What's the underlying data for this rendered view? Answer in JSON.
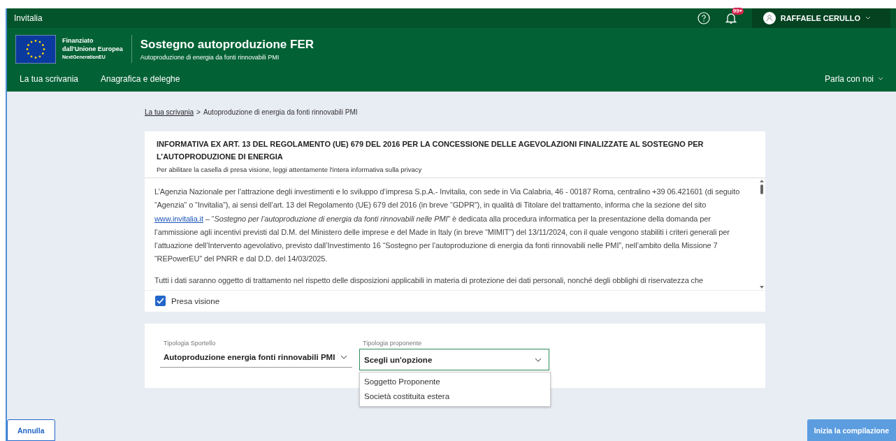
{
  "topbar": {
    "brand": "Invitalia",
    "notifications_badge": "99+",
    "user_name": "RAFFAELE CERULLO"
  },
  "header": {
    "eu_lines": [
      "Finanziato",
      "dall'Unione Europea",
      "NextGenerationEU"
    ],
    "title": "Sostegno autoproduzione FER",
    "subtitle": "Autoproduzione di energia da fonti rinnovabili PMI"
  },
  "nav": {
    "items": [
      {
        "label": "La tua scrivania"
      },
      {
        "label": "Anagrafica e deleghe"
      }
    ],
    "contact": "Parla con noi"
  },
  "breadcrumb": {
    "link": "La tua scrivania",
    "separator": ">",
    "current": "Autoproduzione di energia da fonti rinnovabili PMI"
  },
  "informativa": {
    "title": "INFORMATIVA EX ART. 13 DEL REGOLAMENTO (UE) 679 DEL 2016 PER LA CONCESSIONE DELLE AGEVOLAZIONI FINALIZZATE AL SOSTEGNO PER L’AUTOPRODUZIONE DI ENERGIA",
    "hint": "Per abilitare la casella di presa visione, leggi attentamente l'intera informativa sulla privacy",
    "paragraphs": [
      {
        "before": "L’Agenzia Nazionale per l’attrazione degli investimenti e lo sviluppo d’impresa S.p.A.- Invitalia, con sede in Via Calabria, 46 - 00187 Roma, centralino +39 06.421601 (di seguito “Agenzia” o “Invitalia”), ai sensi dell’art. 13 del Regolamento (UE) 679 del 2016 (in breve  “GDPR”), in qualità di Titolare del trattamento, informa che la sezione del sito ",
        "link": "www.invitalia.it",
        "after": " – “*Sostegno per l’autoproduzione di energia da fonti rinnovabili nelle PMI*” è dedicata alla procedura informatica per la presentazione della domanda per l’ammissione agli incentivi previsti dal D.M. del Ministero delle imprese e del Made in Italy (in breve “MIMIT”) del 13/11/2024, con il quale vengono stabiliti i criteri generali per l’attuazione dell’Intervento agevolativo, previsto dall’Investimento 16 “Sostegno per l’autoproduzione di energia da fonti rinnovabili nelle PMI”, nell’ambito della Missione 7 “REPowerEU” del PNRR e dal D.D. del 14/03/2025."
      },
      {
        "before": "Tutti i dati saranno oggetto di trattamento nel rispetto delle disposizioni applicabili in materia di protezione dei dati personali, nonché degli obblighi di riservatezza che"
      }
    ],
    "acknowledge": {
      "label": "Presa visione",
      "checked": true
    }
  },
  "form": {
    "sportello": {
      "label": "Tipologia Sportello",
      "value": "Autoproduzione energia fonti rinnovabili PMI"
    },
    "proponente": {
      "label": "Tipologia proponente",
      "value": "Scegli un'opzione",
      "expanded": true,
      "options": [
        "Soggetto Proponente",
        "Società costituita estera"
      ]
    }
  },
  "buttons": {
    "cancel": "Annulla",
    "start": "Inizia la compilazione"
  }
}
